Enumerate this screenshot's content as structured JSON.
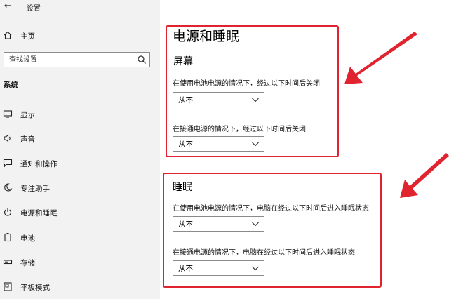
{
  "window": {
    "title": "设置"
  },
  "search": {
    "placeholder": "查找设置"
  },
  "sidebar": {
    "home_label": "主页",
    "section_label": "系统",
    "items": [
      {
        "label": "显示",
        "icon": "monitor-icon"
      },
      {
        "label": "声音",
        "icon": "speaker-icon"
      },
      {
        "label": "通知和操作",
        "icon": "notification-icon"
      },
      {
        "label": "专注助手",
        "icon": "moon-icon"
      },
      {
        "label": "电源和睡眠",
        "icon": "power-icon"
      },
      {
        "label": "电池",
        "icon": "battery-icon"
      },
      {
        "label": "存储",
        "icon": "storage-icon"
      },
      {
        "label": "平板模式",
        "icon": "tablet-icon"
      }
    ]
  },
  "main": {
    "title": "电源和睡眠",
    "screen": {
      "heading": "屏幕",
      "battery_label": "在使用电池电源的情况下，经过以下时间后关闭",
      "battery_value": "从不",
      "plugged_label": "在接通电源的情况下，经过以下时间后关闭",
      "plugged_value": "从不"
    },
    "sleep": {
      "heading": "睡眠",
      "battery_label": "在使用电池电源的情况下，电脑在经过以下时间后进入睡眠状态",
      "battery_value": "从不",
      "plugged_label": "在接通电源的情况下，电脑在经过以下时间后进入睡眠状态",
      "plugged_value": "从不"
    }
  },
  "colors": {
    "annotation_red": "#e0232f",
    "sidebar_bg": "#f2f2f2"
  }
}
